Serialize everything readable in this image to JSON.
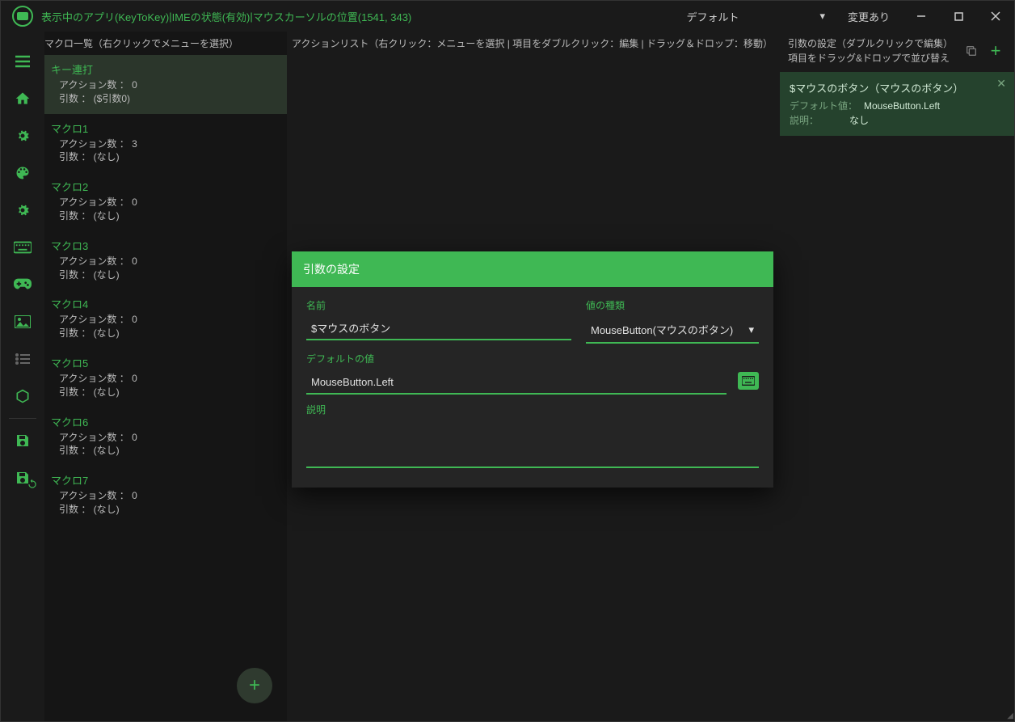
{
  "titlebar": {
    "app_name": "表示中のアプリ(KeyToKey)",
    "ime_status": "IMEの状態(有効)",
    "cursor_pos": "マウスカーソルの位置(1541, 343)",
    "separator": "  |  ",
    "profile_dropdown": "デフォルト",
    "change_status": "変更あり"
  },
  "macro_panel": {
    "header": "マクロ一覧（右クリックでメニューを選択）",
    "items": [
      {
        "name": "キー連打",
        "actions": "アクション数 ： 0",
        "args": "引数 ： ($引数0)"
      },
      {
        "name": "マクロ1",
        "actions": "アクション数 ： 3",
        "args": "引数 ： (なし)"
      },
      {
        "name": "マクロ2",
        "actions": "アクション数 ： 0",
        "args": "引数 ： (なし)"
      },
      {
        "name": "マクロ3",
        "actions": "アクション数 ： 0",
        "args": "引数 ： (なし)"
      },
      {
        "name": "マクロ4",
        "actions": "アクション数 ： 0",
        "args": "引数 ： (なし)"
      },
      {
        "name": "マクロ5",
        "actions": "アクション数 ： 0",
        "args": "引数 ： (なし)"
      },
      {
        "name": "マクロ6",
        "actions": "アクション数 ： 0",
        "args": "引数 ： (なし)"
      },
      {
        "name": "マクロ7",
        "actions": "アクション数 ： 0",
        "args": "引数 ： (なし)"
      }
    ]
  },
  "main_panel": {
    "header": "アクションリスト（右クリック：メニューを選択  |  項目をダブルクリック：編集  |  ドラッグ＆ドロップ：移動）"
  },
  "right_panel": {
    "header_line1": "引数の設定（ダブルクリックで編集）",
    "header_line2": "項目をドラッグ&ドロップで並び替え",
    "card": {
      "title": "$マウスのボタン（マウスのボタン）",
      "default_label": "デフォルト値：",
      "default_value": "MouseButton.Left",
      "desc_label": "説明：",
      "desc_value": "なし"
    }
  },
  "dialog": {
    "title": "引数の設定",
    "name_label": "名前",
    "name_value": "$マウスのボタン",
    "type_label": "値の種類",
    "type_value": "MouseButton(マウスのボタン)",
    "default_label": "デフォルトの値",
    "default_value": "MouseButton.Left",
    "desc_label": "説明"
  }
}
